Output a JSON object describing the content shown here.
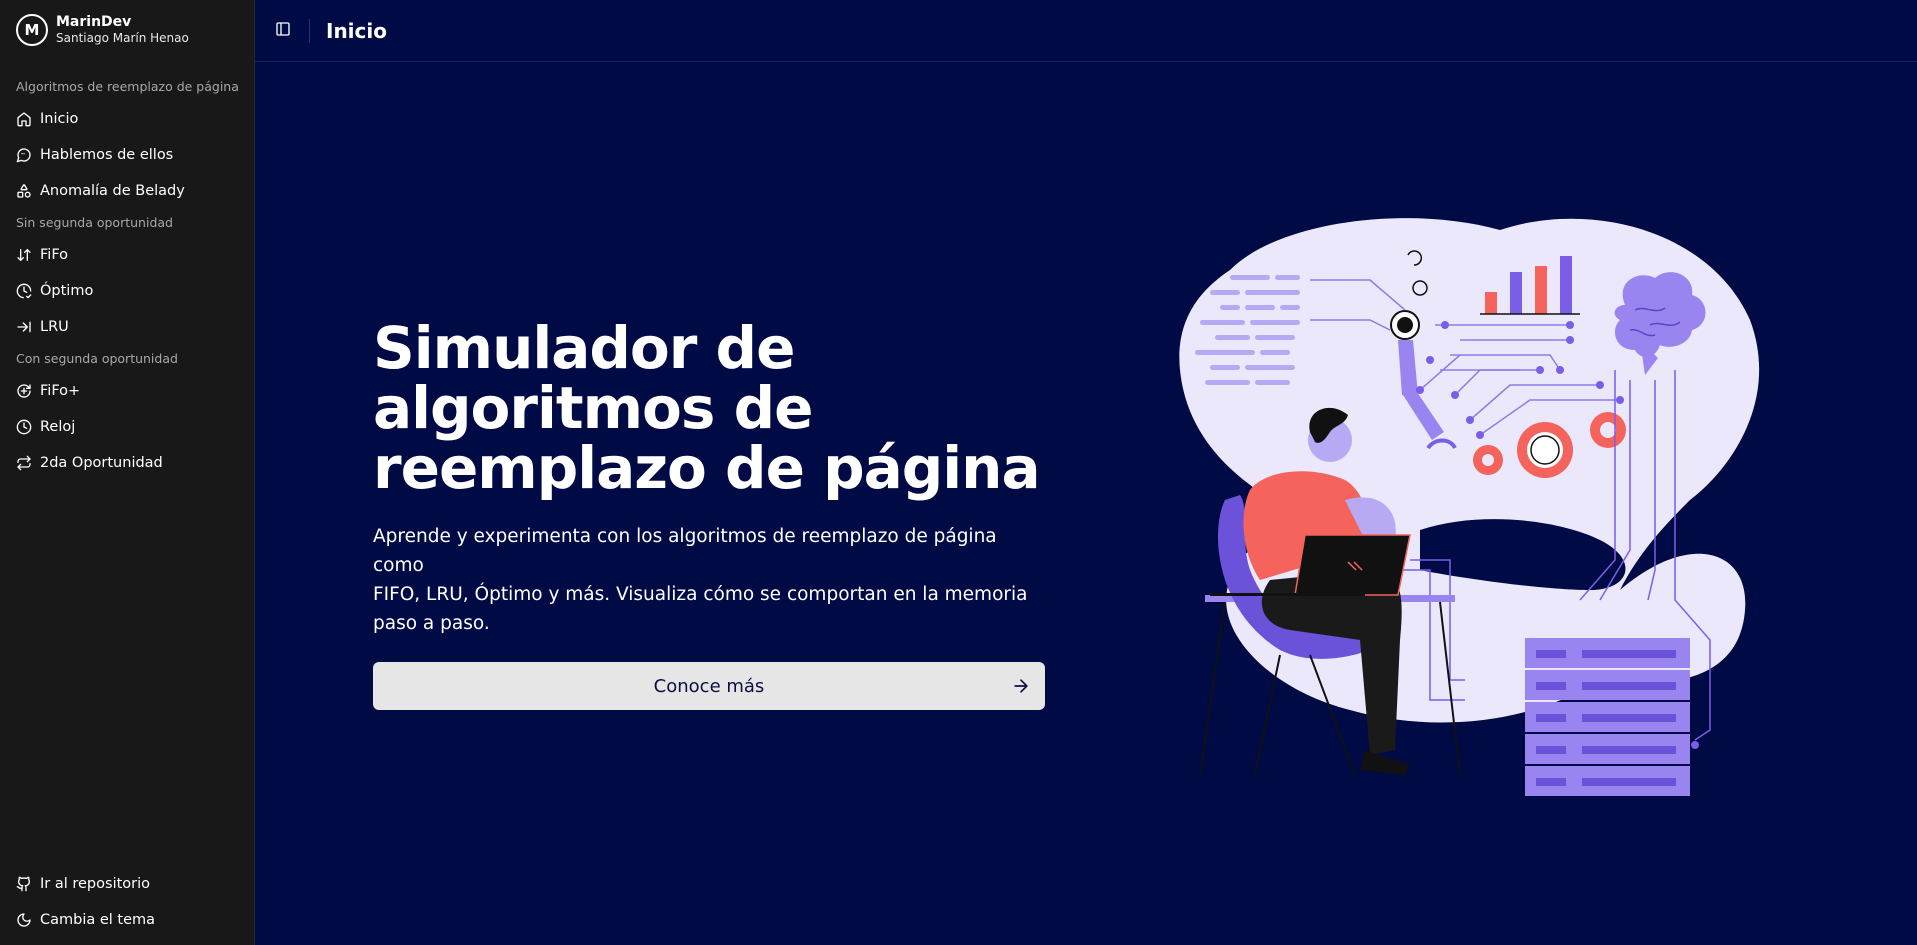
{
  "brand": {
    "logo_letter": "M",
    "name": "MarinDev",
    "author": "Santiago Marín Henao"
  },
  "sidebar": {
    "groups": [
      {
        "label": "Algoritmos de reemplazo de página",
        "items": [
          {
            "label": "Inicio",
            "icon": "home-icon"
          },
          {
            "label": "Hablemos de ellos",
            "icon": "message-circle-icon"
          },
          {
            "label": "Anomalía de Belady",
            "icon": "shapes-icon"
          }
        ]
      },
      {
        "label": "Sin segunda oportunidad",
        "items": [
          {
            "label": "FiFo",
            "icon": "arrow-up-down-icon"
          },
          {
            "label": "Óptimo",
            "icon": "clock-check-icon"
          },
          {
            "label": "LRU",
            "icon": "arrow-right-to-line-icon"
          }
        ]
      },
      {
        "label": "Con segunda oportunidad",
        "items": [
          {
            "label": "FiFo+",
            "icon": "rotate-arrow-icon"
          },
          {
            "label": "Reloj",
            "icon": "clock-icon"
          },
          {
            "label": "2da Oportunidad",
            "icon": "repeat-icon"
          }
        ]
      }
    ],
    "footer": [
      {
        "label": "Ir al repositorio",
        "icon": "github-icon"
      },
      {
        "label": "Cambia el tema",
        "icon": "moon-icon"
      }
    ]
  },
  "topbar": {
    "title": "Inicio",
    "toggle_icon": "panel-left-icon"
  },
  "hero": {
    "title_line1": "Simulador de",
    "title_line2": "algoritmos de",
    "title_line3": "reemplazo de página",
    "description_line1": "Aprende y experimenta con los algoritmos de reemplazo de página como",
    "description_line2": "FIFO, LRU, Óptimo y más. Visualiza cómo se comportan en la memoria",
    "description_line3": "paso a paso.",
    "cta_label": "Conoce más",
    "cta_icon": "arrow-right-icon"
  },
  "colors": {
    "background": "#000b45",
    "sidebar": "#181818",
    "blob": "#ece8fc",
    "accent_purple": "#9a85f0",
    "accent_red": "#f4635c",
    "button_bg": "#e6e6e6"
  }
}
